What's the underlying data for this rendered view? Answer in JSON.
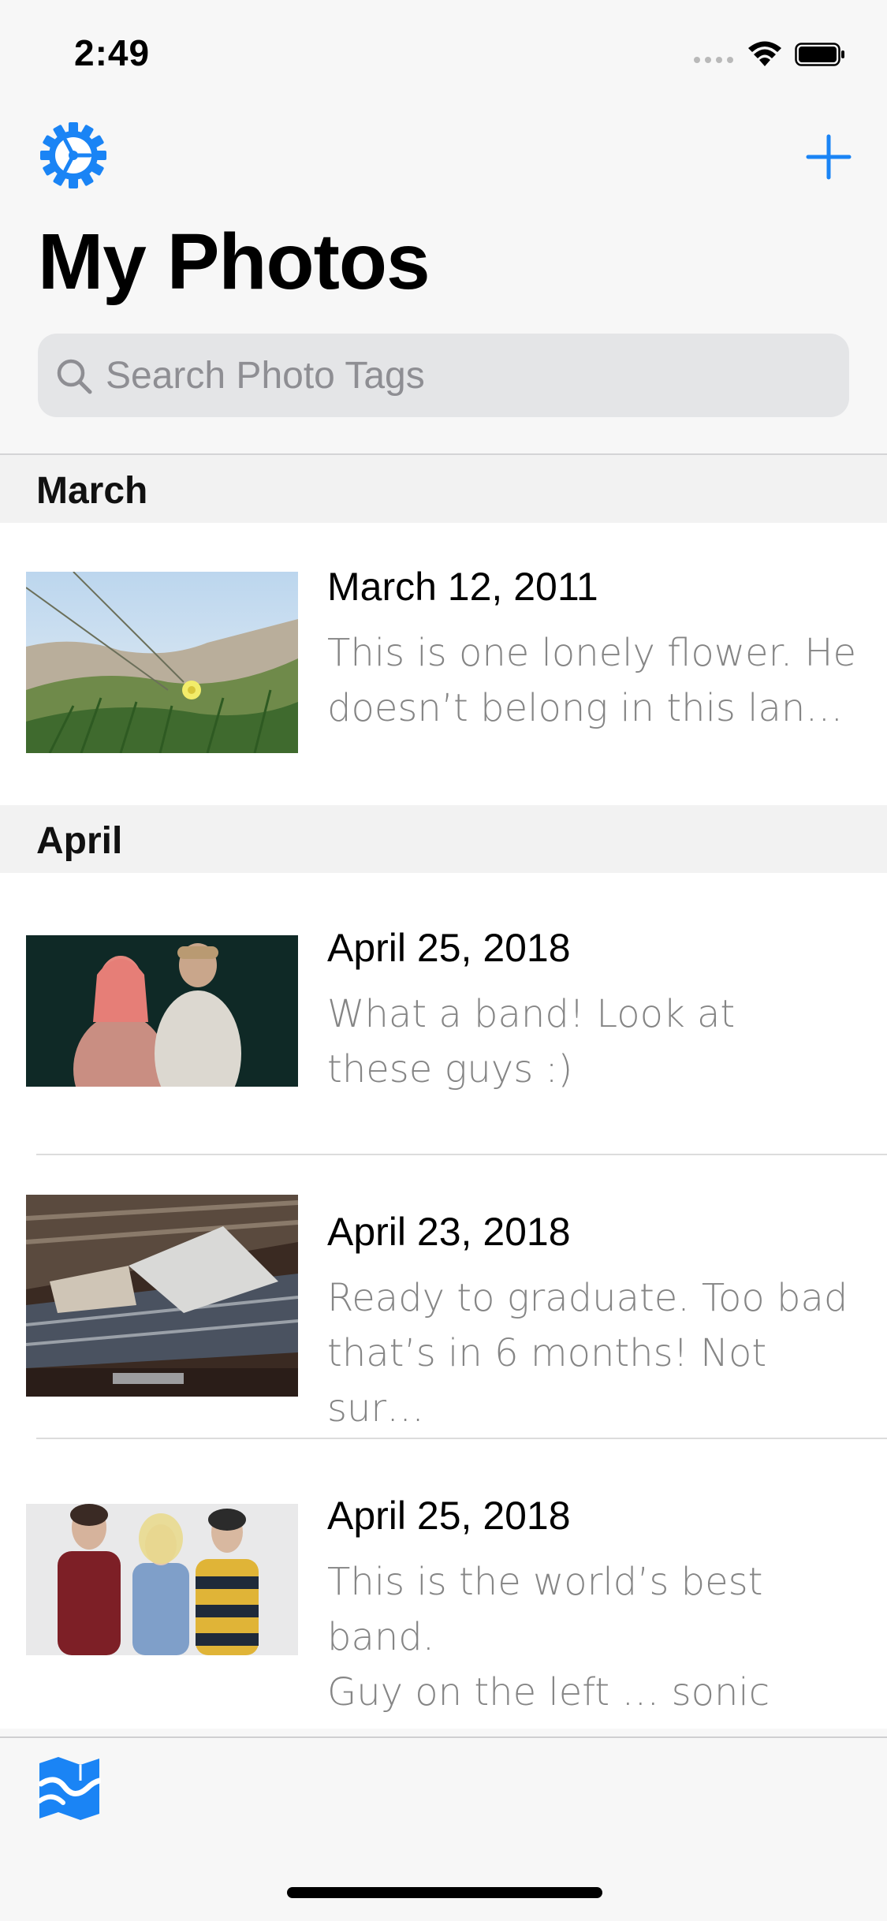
{
  "status_bar": {
    "time": "2:49"
  },
  "nav": {
    "settings_icon": "gear-icon",
    "add_icon": "plus-icon",
    "title": "My Photos",
    "search_placeholder": "Search Photo Tags"
  },
  "sections": [
    {
      "header": "March",
      "rows": [
        {
          "date": "March 12, 2011",
          "line1": "This is one lonely flower. He",
          "line2": "doesn’t belong in this lan…"
        }
      ]
    },
    {
      "header": "April",
      "rows": [
        {
          "date": "April 25, 2018",
          "line1": "What a band! Look at",
          "line2": "these guys :)"
        },
        {
          "date": "April 23, 2018",
          "line1": "Ready to graduate. Too bad",
          "line2": "that’s in 6 months! Not sur…"
        },
        {
          "date": "April 25, 2018",
          "line1": "This is the world’s best band.",
          "line2": "Guy on the left … sonic ge…"
        }
      ]
    }
  ],
  "tab_bar": {
    "map_icon": "map-icon"
  },
  "colors": {
    "accent": "#1a84f5",
    "background": "#f7f7f7",
    "secondary_text": "#858585"
  }
}
